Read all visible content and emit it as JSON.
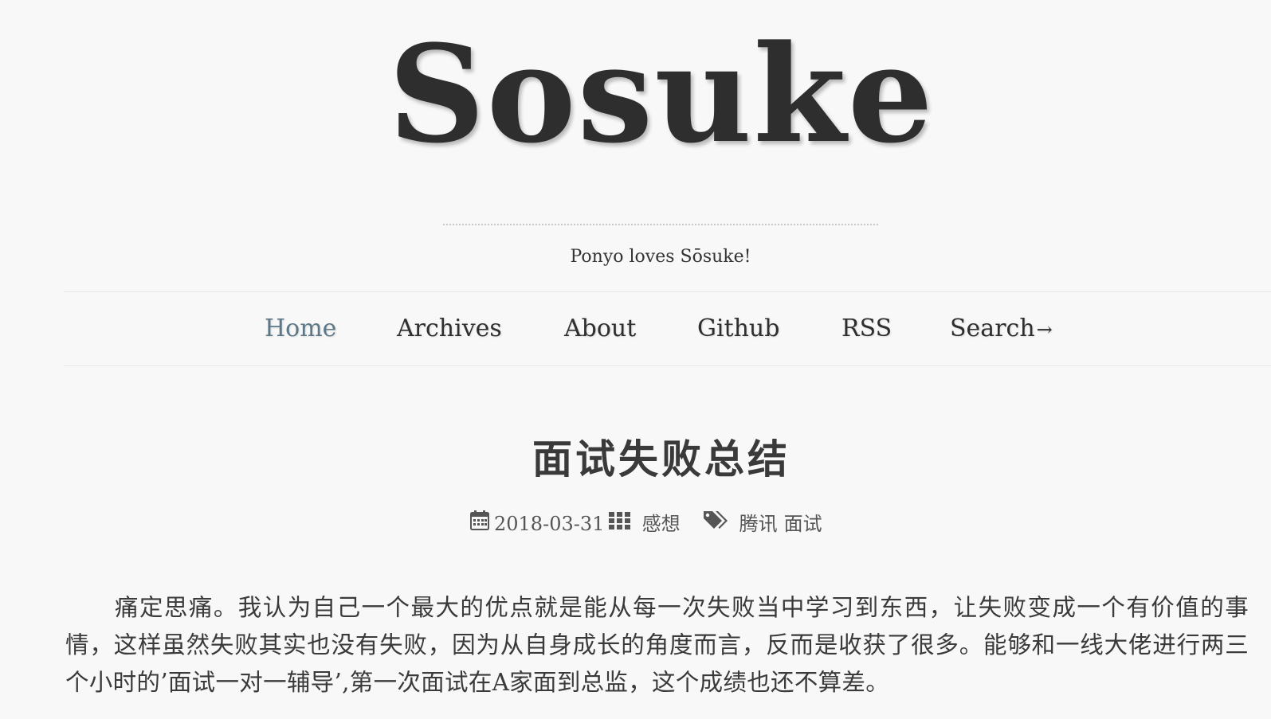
{
  "site": {
    "logo_text": "Sosuke",
    "tagline": "Ponyo loves Sōsuke!"
  },
  "nav": {
    "home": "Home",
    "archives": "Archives",
    "about": "About",
    "github": "Github",
    "rss": "RSS",
    "search": "Search",
    "search_arrow": "→"
  },
  "post": {
    "title": "面试失败总结",
    "date": "2018-03-31",
    "category": "感想",
    "tags": [
      "腾讯",
      "面试"
    ],
    "body": "痛定思痛。我认为自己一个最大的优点就是能从每一次失败当中学习到东西，让失败变成一个有价值的事情，这样虽然失败其实也没有失败，因为从自身成长的角度而言，反而是收获了很多。能够和一线大佬进行两三个小时的’面试一对一辅导’,第一次面试在A家面到总监，这个成绩也还不算差。"
  },
  "icons": {
    "date": "calendar-icon",
    "category": "grid-icon",
    "tags": "tags-icon"
  },
  "colors": {
    "background": "#f8f8f8",
    "active_nav": "#5e7888",
    "text": "#3a3a3a"
  }
}
